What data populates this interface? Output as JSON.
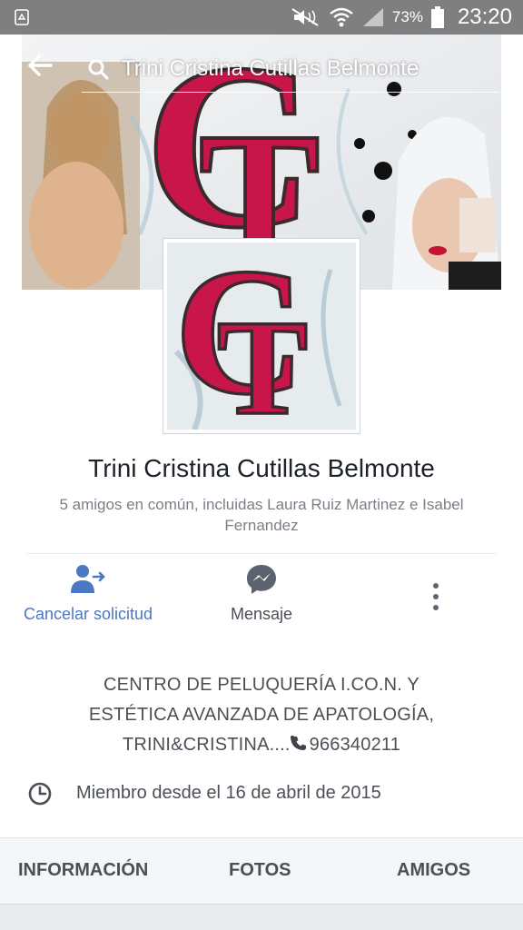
{
  "status_bar": {
    "battery": "73%",
    "time": "23:20",
    "icons": [
      "recycle-icon",
      "mute-icon",
      "wifi-icon",
      "signal-icon",
      "battery-icon"
    ]
  },
  "topbar": {
    "search_text": "Trini Cristina Cutillas Belmonte",
    "icons": [
      "back-arrow-icon",
      "search-icon"
    ]
  },
  "profile": {
    "name": "Trini Cristina Cutillas Belmonte",
    "mutual_friends": "5 amigos en común, incluidas Laura Ruiz Martinez e Isabel Fernandez"
  },
  "actions": {
    "cancel_label": "Cancelar solicitud",
    "message_label": "Mensaje",
    "icons": [
      "friend-request-sent-icon",
      "messenger-icon",
      "more-options-icon"
    ]
  },
  "bio": {
    "lines": [
      "CENTRO DE PELUQUERÍA I.CO.N. Y",
      "ESTÉTICA AVANZADA DE APATOLOGÍA,",
      "TRINI&CRISTINA...."
    ],
    "phone": "966340211"
  },
  "member_since": "Miembro desde el 16 de abril de 2015",
  "tabs": [
    "INFORMACIÓN",
    "FOTOS",
    "AMIGOS"
  ],
  "colors": {
    "accent": "#4a78c2",
    "logo_red": "#c8164a",
    "status_bar": "#7f7f7f"
  }
}
